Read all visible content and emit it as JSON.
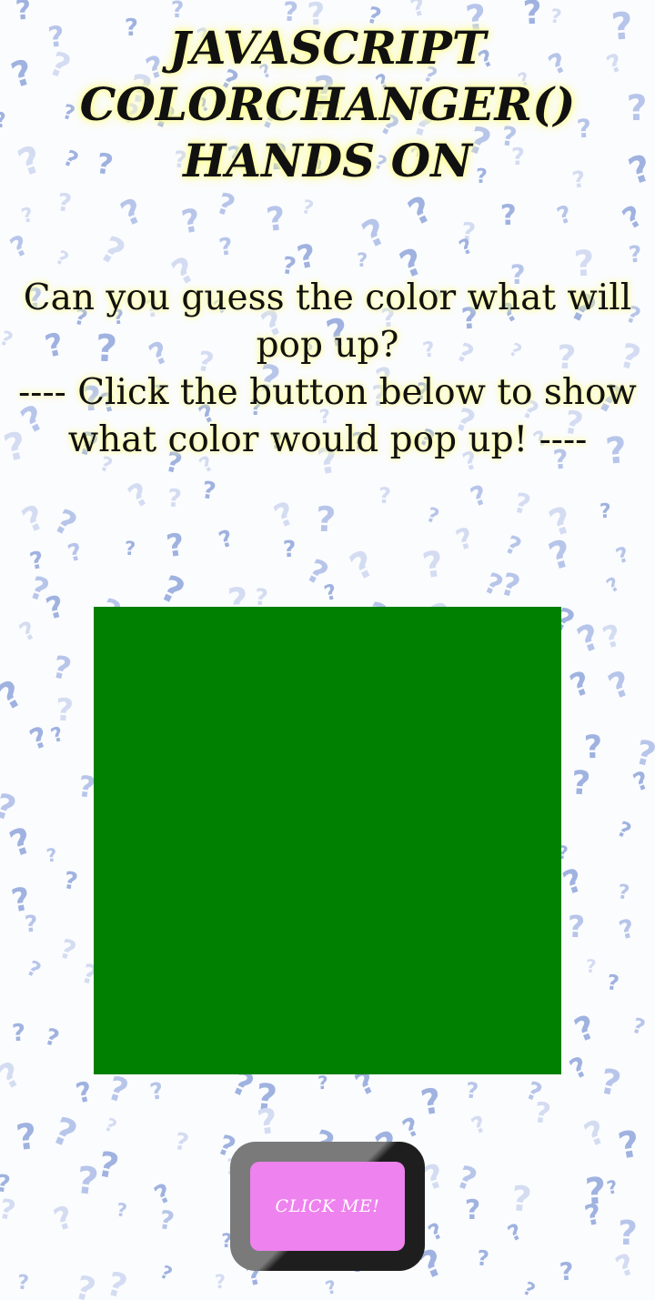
{
  "page": {
    "title": "JAVASCRIPT COLORCHANGER() HANDS ON",
    "prompt_line": "Can you guess the color what will pop up?",
    "instruction_line": "---- Click the button below to show what color would pop up! ----"
  },
  "color_box": {
    "current_color": "#008000"
  },
  "button": {
    "label": "CLICK ME!",
    "color": "#ee82ee"
  },
  "background": {
    "pattern_icon": "question-mark-icon",
    "colors": [
      "#9fb2e0",
      "#b7c5ea",
      "#d4dcf2"
    ]
  }
}
